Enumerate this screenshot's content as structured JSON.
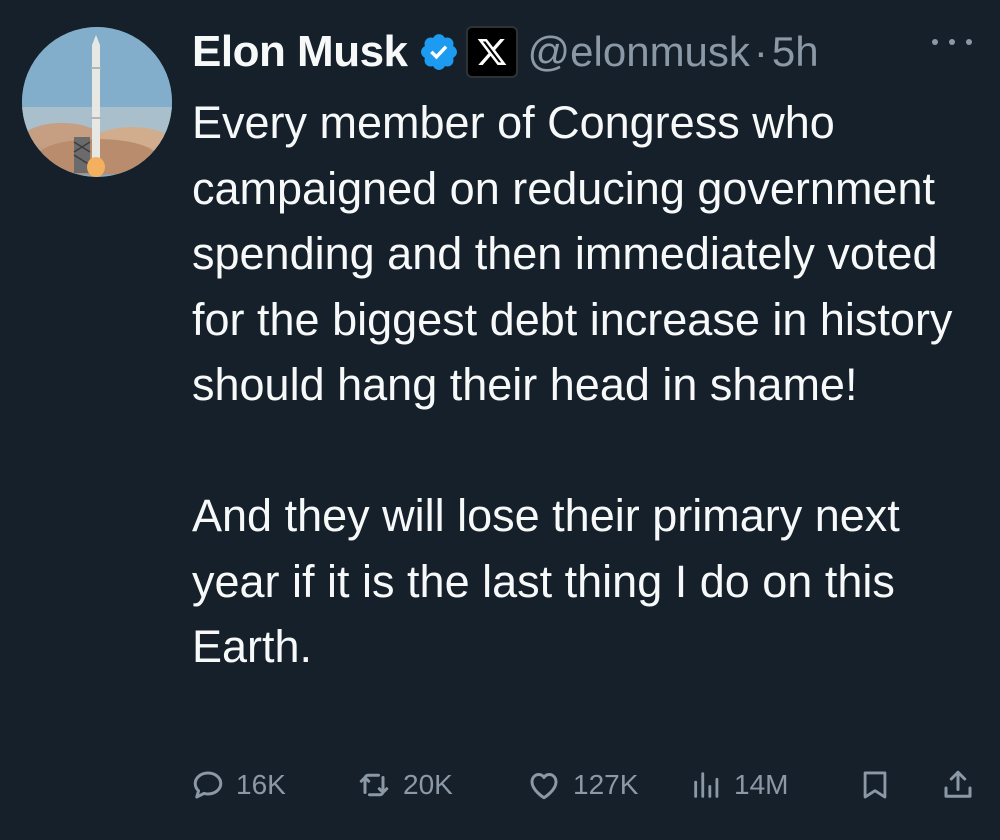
{
  "tweet": {
    "author_name": "Elon Musk",
    "handle": "@elonmusk",
    "separator": "·",
    "time": "5h",
    "paragraphs": [
      "Every member of Congress who campaigned on reducing government spending and then immediately voted for the biggest debt increase in history should hang their head in shame!",
      "And they will lose their primary next year if it is the last thing I do on this Earth."
    ]
  },
  "stats": {
    "replies": "16K",
    "retweets": "20K",
    "likes": "127K",
    "views": "14M"
  },
  "icons": {
    "verified": "verified-badge-icon",
    "affiliate": "x-logo-icon",
    "more": "more-options-icon",
    "reply": "reply-icon",
    "retweet": "retweet-icon",
    "like": "heart-icon",
    "views": "views-chart-icon",
    "bookmark": "bookmark-icon",
    "share": "share-icon"
  },
  "colors": {
    "background": "#15202b",
    "text": "#f7f9f9",
    "muted": "#8b98a5",
    "verified": "#1d9bf0"
  }
}
